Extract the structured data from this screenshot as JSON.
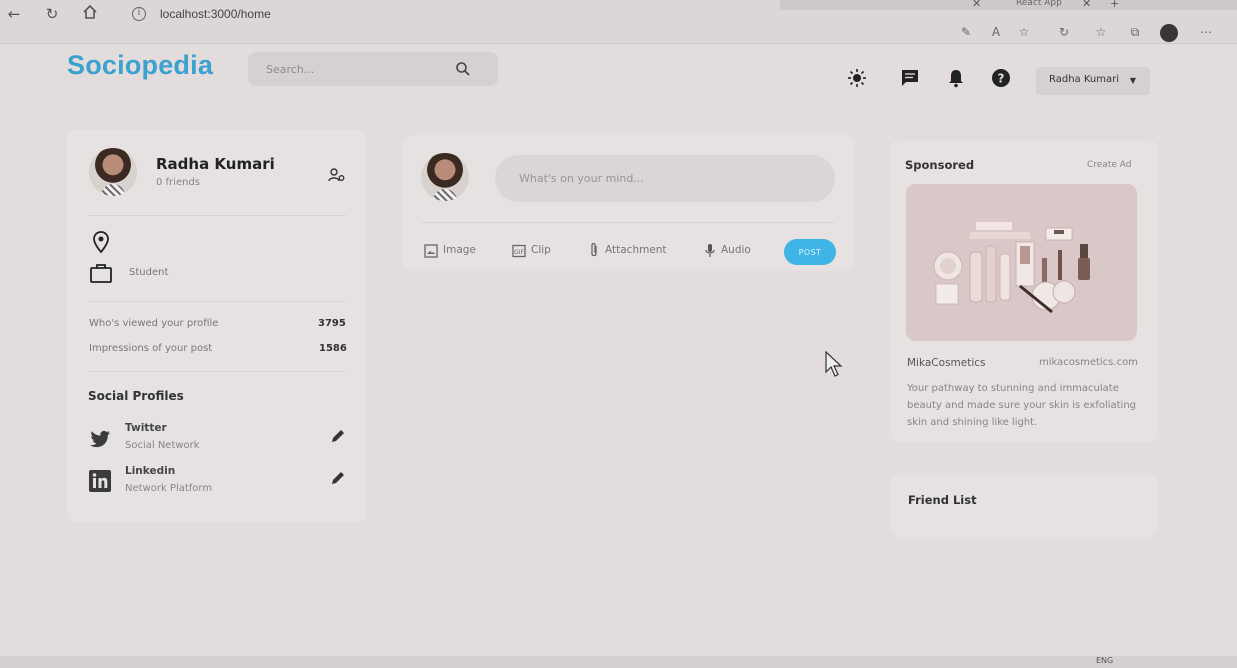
{
  "browser": {
    "url": "localhost:3000/home",
    "tab_title": "React App",
    "nav": {
      "back_icon": "arrow-left-icon",
      "reload_icon": "reload-icon",
      "home_icon": "home-icon"
    }
  },
  "app": {
    "logo": "Sociopedia",
    "accent_color": "#3ba1cf",
    "search": {
      "placeholder": "Search..."
    },
    "nav_icons": [
      "sun-icon",
      "message-icon",
      "bell-icon",
      "help-icon"
    ],
    "user_menu": {
      "selected": "Radha Kumari"
    }
  },
  "profile": {
    "name": "Radha Kumari",
    "friends": "0 friends",
    "location": "",
    "occupation": "Student",
    "stats": [
      {
        "label": "Who's viewed your profile",
        "value": "3795"
      },
      {
        "label": "Impressions of your post",
        "value": "1586"
      }
    ],
    "social_heading": "Social Profiles",
    "socials": [
      {
        "name": "Twitter",
        "subtitle": "Social Network",
        "icon": "twitter-icon"
      },
      {
        "name": "Linkedin",
        "subtitle": "Network Platform",
        "icon": "linkedin-icon"
      }
    ]
  },
  "composer": {
    "placeholder": "What's on your mind...",
    "actions": [
      {
        "label": "Image",
        "icon": "image-icon"
      },
      {
        "label": "Clip",
        "icon": "clip-icon"
      },
      {
        "label": "Attachment",
        "icon": "attachment-icon"
      },
      {
        "label": "Audio",
        "icon": "mic-icon"
      }
    ],
    "post_label": "POST",
    "post_color": "#3fb4e5"
  },
  "sponsored": {
    "heading": "Sponsored",
    "create_ad": "Create Ad",
    "brand": "MikaCosmetics",
    "site": "mikacosmetics.com",
    "description": "Your pathway to stunning and immaculate beauty and made sure your skin is exfoliating skin and shining like light."
  },
  "friend_list": {
    "heading": "Friend List"
  },
  "taskbar": {
    "lang": "ENG"
  }
}
